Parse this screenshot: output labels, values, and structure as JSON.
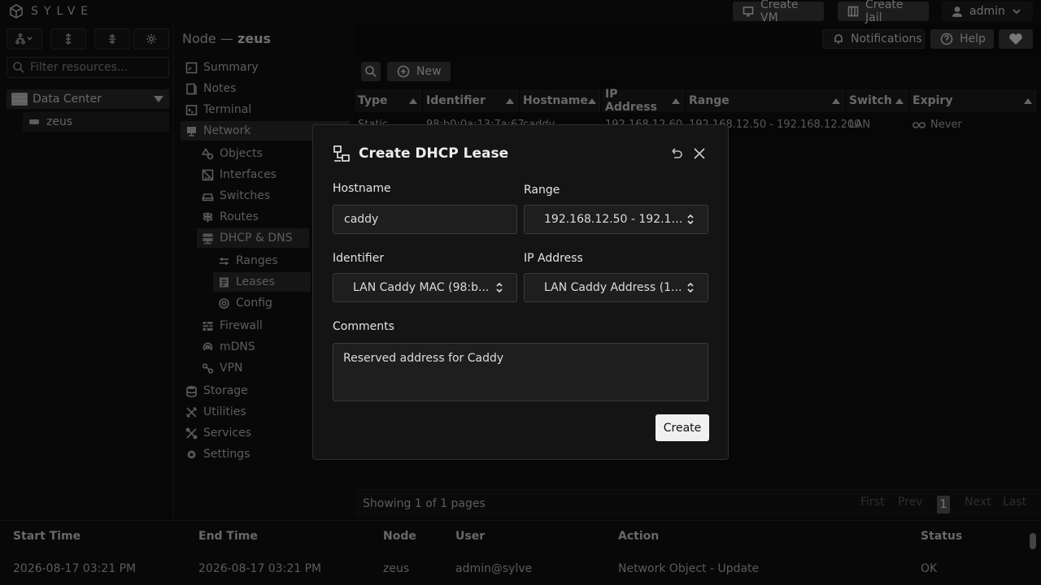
{
  "brand": {
    "name": "SYLVE"
  },
  "topbar": {
    "create_vm": "Create VM",
    "create_jail": "Create Jail",
    "user": "admin"
  },
  "left": {
    "search_placeholder": "Filter resources...",
    "datacenter": "Data Center",
    "node": "zeus"
  },
  "breadcrumb": {
    "prefix": "Node —",
    "node": "zeus"
  },
  "header_actions": {
    "notifications": "Notifications",
    "help": "Help"
  },
  "nav": {
    "summary": "Summary",
    "notes": "Notes",
    "terminal": "Terminal",
    "network": "Network",
    "objects": "Objects",
    "interfaces": "Interfaces",
    "switches": "Switches",
    "routes": "Routes",
    "dhcp_dns": "DHCP & DNS",
    "ranges": "Ranges",
    "leases": "Leases",
    "config": "Config",
    "firewall": "Firewall",
    "mdns": "mDNS",
    "vpn": "VPN",
    "storage": "Storage",
    "utilities": "Utilities",
    "services": "Services",
    "settings": "Settings"
  },
  "toolbar": {
    "new_label": "New"
  },
  "table": {
    "columns": [
      "Type",
      "Identifier",
      "Hostname",
      "IP Address",
      "Range",
      "Switch",
      "Expiry"
    ],
    "rows": [
      {
        "type": "Static",
        "identifier": "98:b0:0a:13:7a:67",
        "hostname": "caddy",
        "ip": "192.168.12.60",
        "range": "192.168.12.50 - 192.168.12.200",
        "switch": "LAN",
        "expiry": "Never"
      }
    ],
    "pages_text": "Showing 1 of 1 pages",
    "pager": {
      "first": "First",
      "prev": "Prev",
      "current": "1",
      "next": "Next",
      "last": "Last"
    }
  },
  "log": {
    "columns": [
      "Start Time",
      "End Time",
      "Node",
      "User",
      "Action",
      "Status"
    ],
    "rows": [
      {
        "start": "2026-08-17 03:21 PM",
        "end": "2026-08-17 03:21 PM",
        "node": "zeus",
        "user": "admin@sylve",
        "action": "Network Object - Update",
        "status": "OK"
      }
    ]
  },
  "modal": {
    "title": "Create DHCP Lease",
    "hostname_label": "Hostname",
    "hostname_value": "caddy",
    "range_label": "Range",
    "range_value": "192.168.12.50 - 192.16...",
    "identifier_label": "Identifier",
    "identifier_value": "LAN Caddy MAC (98:b...",
    "ip_label": "IP Address",
    "ip_value": "LAN Caddy Address (1...",
    "comments_label": "Comments",
    "comments_value": "Reserved address for Caddy",
    "create_label": "Create"
  }
}
